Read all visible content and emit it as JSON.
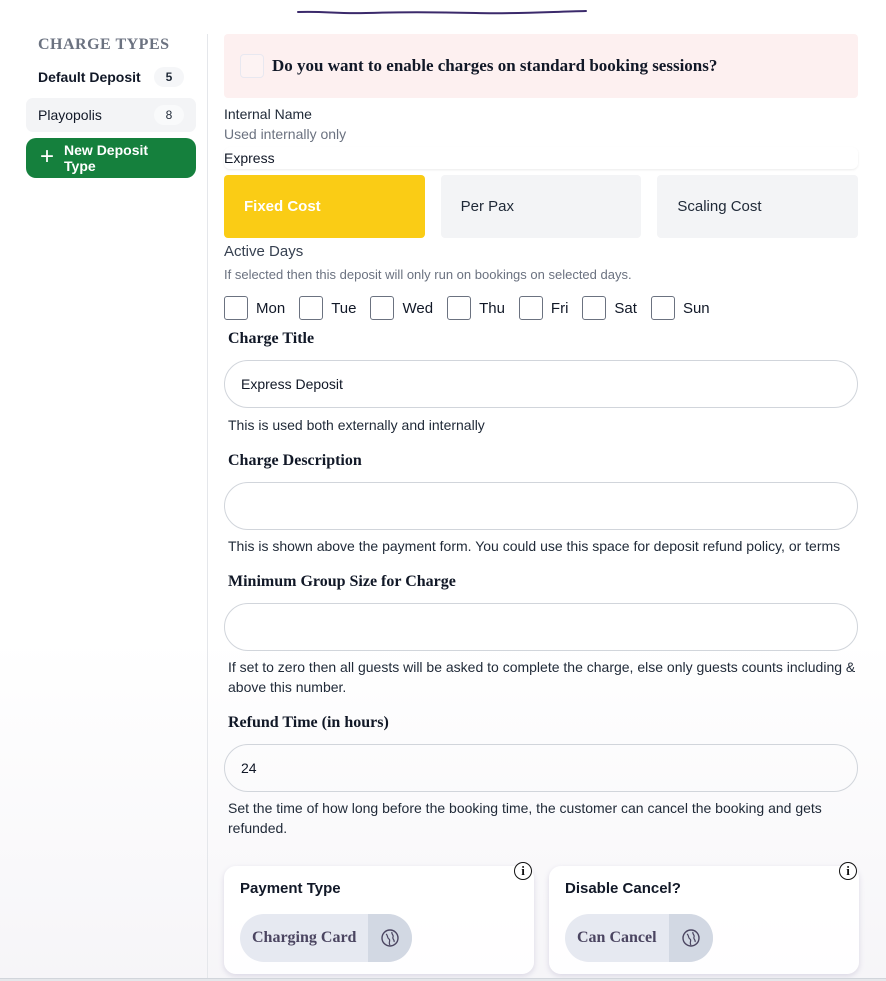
{
  "sidebar": {
    "title": "CHARGE TYPES",
    "items": [
      {
        "label": "Default Deposit",
        "count": "5"
      },
      {
        "label": "Playopolis",
        "count": "8"
      }
    ],
    "new_button_label": "New Deposit Type",
    "new_button_icon": "plus-icon"
  },
  "main": {
    "enable_banner": {
      "text": "Do you want to enable charges on standard booking sessions?",
      "checked": false
    },
    "internal_name": {
      "label": "Internal Name",
      "sublabel": "Used internally only",
      "value": "Express"
    },
    "cost_types": [
      {
        "label": "Fixed Cost",
        "selected": true
      },
      {
        "label": "Per Pax",
        "selected": false
      },
      {
        "label": "Scaling Cost",
        "selected": false
      }
    ],
    "active_days": {
      "label": "Active Days",
      "sublabel": "If selected then this deposit will only run on bookings on selected days.",
      "days": [
        "Mon",
        "Tue",
        "Wed",
        "Thu",
        "Fri",
        "Sat",
        "Sun"
      ]
    },
    "charge_title": {
      "label": "Charge Title",
      "value": "Express Deposit",
      "help": "This is used both externally and internally"
    },
    "charge_description": {
      "label": "Charge Description",
      "value": "",
      "help": "This is shown above the payment form. You could use this space for deposit refund policy, or terms"
    },
    "min_group_size": {
      "label": "Minimum Group Size for Charge",
      "value": "",
      "help": "If set to zero then all guests will be asked to complete the charge, else only guests counts including & above this number."
    },
    "refund_time": {
      "label": "Refund Time (in hours)",
      "value": "24",
      "help": "Set the time of how long before the booking time, the customer can cancel the booking and gets refunded."
    },
    "payment_type": {
      "title": "Payment Type",
      "value": "Charging Card",
      "info_icon": "info-icon"
    },
    "disable_cancel": {
      "title": "Disable Cancel?",
      "value": "Can Cancel",
      "info_icon": "info-icon"
    }
  },
  "colors": {
    "primary_green": "#15803d",
    "selected_yellow": "#facc15",
    "banner_bg": "#fdf0f0"
  }
}
